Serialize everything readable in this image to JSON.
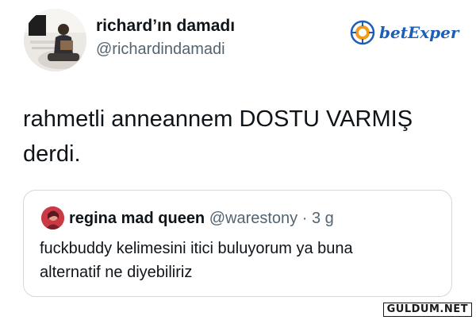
{
  "tweet": {
    "author": {
      "display_name": "richard’ın damadı",
      "handle": "@richardindamadi"
    },
    "text_line1": "rahmetli anneannem DOSTU VARMIŞ",
    "text_line2": "derdi.",
    "brand_logo_text": "betExper",
    "quoted": {
      "display_name": "regina mad queen",
      "handle": "@warestony",
      "separator": " · ",
      "time": "3 g",
      "text_line1": "fuckbuddy kelimesini itici buluyorum ya buna",
      "text_line2": "alternatif ne diyebiliriz"
    }
  },
  "watermark": "GULDUM.NET",
  "colors": {
    "text": "#0f1419",
    "secondary": "#536471",
    "border": "#cfd9de",
    "logo_blue": "#1d5fb8",
    "logo_orange": "#f29a1a"
  }
}
